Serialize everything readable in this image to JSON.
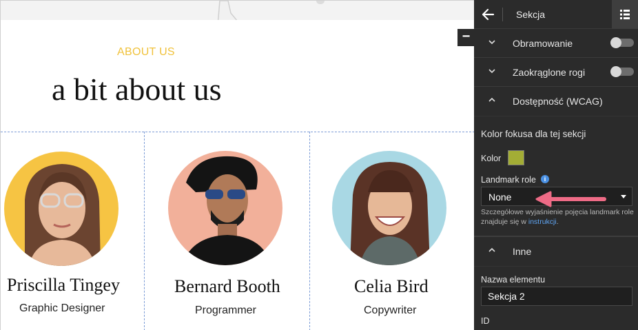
{
  "canvas": {
    "about_label": "ABOUT US",
    "about_title": "a bit about us",
    "collapse_symbol": "−",
    "team": [
      {
        "name": "Priscilla Tingey",
        "role": "Graphic Designer",
        "bg": "#f6c443"
      },
      {
        "name": "Bernard Booth",
        "role": "Programmer",
        "bg": "#f2b09a"
      },
      {
        "name": "Celia Bird",
        "role": "Copywriter",
        "bg": "#a9d8e4"
      }
    ]
  },
  "panel": {
    "back_icon": "arrow-left-icon",
    "title": "Sekcja",
    "grid_icon": "list-grid-icon",
    "sections": {
      "border": {
        "label": "Obramowanie",
        "toggle_on": false
      },
      "rounded": {
        "label": "Zaokrąglone rogi",
        "toggle_on": false
      },
      "wcag": {
        "label": "Dostępność (WCAG)"
      }
    },
    "focus_heading": "Kolor fokusa dla tej sekcji",
    "color_label": "Kolor",
    "focus_color": "#a3ad35",
    "landmark_label": "Landmark role",
    "landmark_value": "None",
    "hint_text": "Szczegółowe wyjaśnienie pojęcia landmark role znajduje się w ",
    "hint_link": "instrukcji",
    "hint_end": ".",
    "other_section": "Inne",
    "name_label": "Nazwa elementu",
    "name_value": "Sekcja 2",
    "id_label": "ID"
  },
  "colors": {
    "accent_yellow": "#f0c23b",
    "panel_bg": "#2b2b2b",
    "link_blue": "#5ea4f2",
    "arrow_pink": "#ee6b86"
  }
}
